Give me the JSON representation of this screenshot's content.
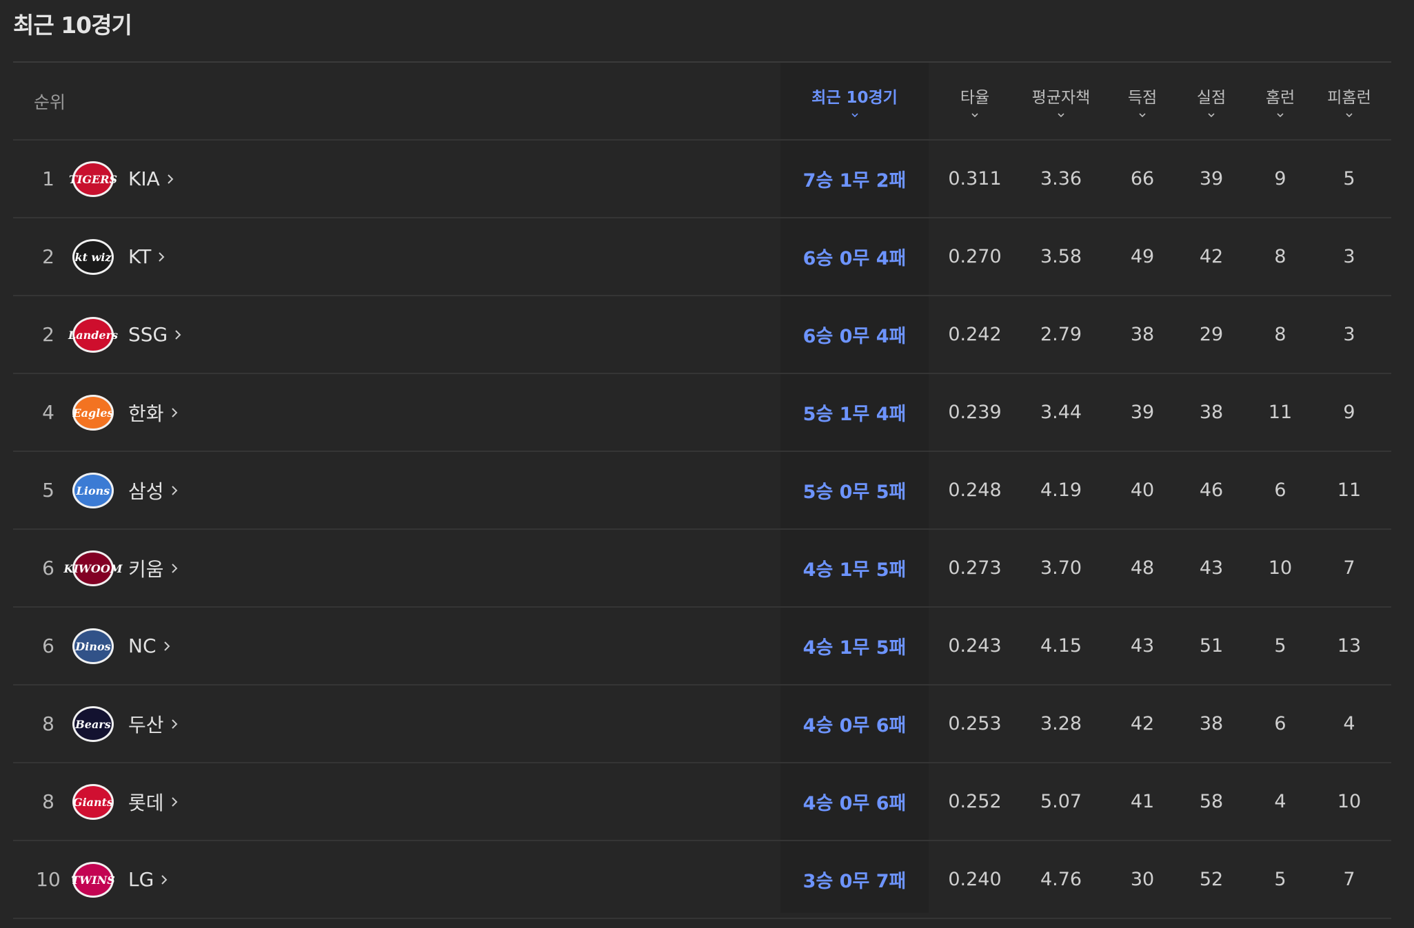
{
  "title": "최근 10경기",
  "headers": {
    "rank": "순위",
    "recent": "최근 10경기",
    "avg": "타율",
    "era": "평균자책",
    "runs": "득점",
    "runs_allowed": "실점",
    "hr": "홈런",
    "hr_allowed": "피홈런"
  },
  "rows": [
    {
      "rank": "1",
      "team": "KIA",
      "logo_text": "TIGERS",
      "logo_color": "#c8102e",
      "record": "7승 1무 2패",
      "avg": "0.311",
      "era": "3.36",
      "runs": "66",
      "runs_allowed": "39",
      "hr": "9",
      "hr_allowed": "5"
    },
    {
      "rank": "2",
      "team": "KT",
      "logo_text": "kt wiz",
      "logo_color": "#1a1a1a",
      "record": "6승 0무 4패",
      "avg": "0.270",
      "era": "3.58",
      "runs": "49",
      "runs_allowed": "42",
      "hr": "8",
      "hr_allowed": "3"
    },
    {
      "rank": "2",
      "team": "SSG",
      "logo_text": "Landers",
      "logo_color": "#ce0e2d",
      "record": "6승 0무 4패",
      "avg": "0.242",
      "era": "2.79",
      "runs": "38",
      "runs_allowed": "29",
      "hr": "8",
      "hr_allowed": "3"
    },
    {
      "rank": "4",
      "team": "한화",
      "logo_text": "Eagles",
      "logo_color": "#f37321",
      "record": "5승 1무 4패",
      "avg": "0.239",
      "era": "3.44",
      "runs": "39",
      "runs_allowed": "38",
      "hr": "11",
      "hr_allowed": "9"
    },
    {
      "rank": "5",
      "team": "삼성",
      "logo_text": "Lions",
      "logo_color": "#3b7bd4",
      "record": "5승 0무 5패",
      "avg": "0.248",
      "era": "4.19",
      "runs": "40",
      "runs_allowed": "46",
      "hr": "6",
      "hr_allowed": "11"
    },
    {
      "rank": "6",
      "team": "키움",
      "logo_text": "KIWOOM",
      "logo_color": "#820024",
      "record": "4승 1무 5패",
      "avg": "0.273",
      "era": "3.70",
      "runs": "48",
      "runs_allowed": "43",
      "hr": "10",
      "hr_allowed": "7"
    },
    {
      "rank": "6",
      "team": "NC",
      "logo_text": "Dinos",
      "logo_color": "#315288",
      "record": "4승 1무 5패",
      "avg": "0.243",
      "era": "4.15",
      "runs": "43",
      "runs_allowed": "51",
      "hr": "5",
      "hr_allowed": "13"
    },
    {
      "rank": "8",
      "team": "두산",
      "logo_text": "Bears",
      "logo_color": "#131230",
      "record": "4승 0무 6패",
      "avg": "0.253",
      "era": "3.28",
      "runs": "42",
      "runs_allowed": "38",
      "hr": "6",
      "hr_allowed": "4"
    },
    {
      "rank": "8",
      "team": "롯데",
      "logo_text": "Giants",
      "logo_color": "#d00f31",
      "record": "4승 0무 6패",
      "avg": "0.252",
      "era": "5.07",
      "runs": "41",
      "runs_allowed": "58",
      "hr": "4",
      "hr_allowed": "10"
    },
    {
      "rank": "10",
      "team": "LG",
      "logo_text": "TWINS",
      "logo_color": "#c30452",
      "record": "3승 0무 7패",
      "avg": "0.240",
      "era": "4.76",
      "runs": "30",
      "runs_allowed": "52",
      "hr": "5",
      "hr_allowed": "7"
    }
  ]
}
